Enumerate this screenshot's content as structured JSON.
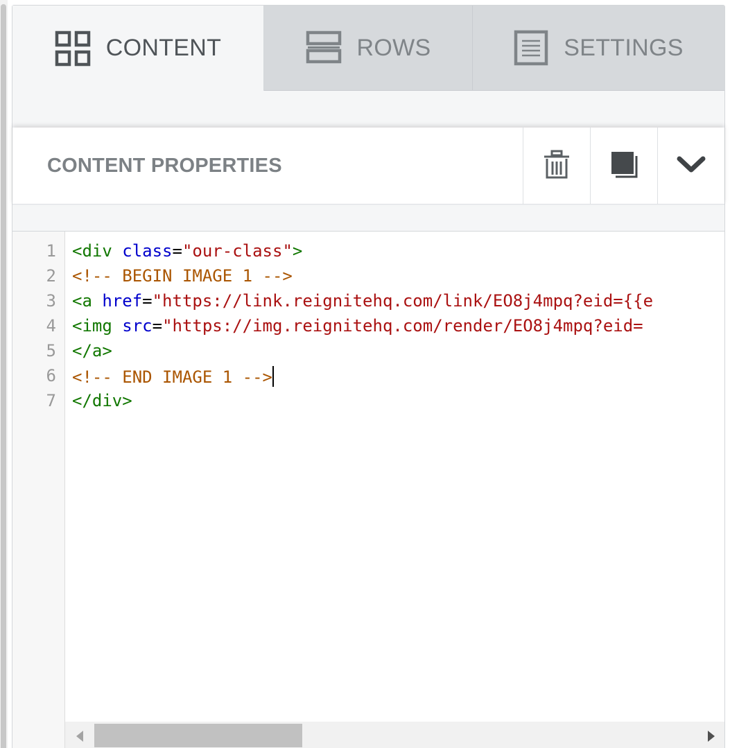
{
  "tabs": {
    "content": {
      "label": "CONTENT",
      "icon": "grid-icon"
    },
    "rows": {
      "label": "ROWS",
      "icon": "rows-icon"
    },
    "settings": {
      "label": "SETTINGS",
      "icon": "settings-doc-icon"
    }
  },
  "properties": {
    "title": "CONTENT PROPERTIES",
    "actions": [
      "trash-icon",
      "duplicate-icon",
      "chevron-down-icon"
    ]
  },
  "editor": {
    "line_numbers": [
      "1",
      "2",
      "3",
      "4",
      "5",
      "6",
      "7"
    ],
    "lines": [
      {
        "parts": [
          {
            "t": "<div",
            "c": "tag"
          },
          {
            "t": " ",
            "c": ""
          },
          {
            "t": "class",
            "c": "attr"
          },
          {
            "t": "=",
            "c": ""
          },
          {
            "t": "\"our-class\"",
            "c": "str"
          },
          {
            "t": ">",
            "c": "tag"
          }
        ]
      },
      {
        "parts": [
          {
            "t": "<!-- BEGIN IMAGE 1 -->",
            "c": "cmt"
          }
        ]
      },
      {
        "parts": [
          {
            "t": "<a",
            "c": "tag"
          },
          {
            "t": " ",
            "c": ""
          },
          {
            "t": "href",
            "c": "attr"
          },
          {
            "t": "=",
            "c": ""
          },
          {
            "t": "\"https://link.reignitehq.com/link/EO8j4mpq?eid={{e",
            "c": "str"
          }
        ]
      },
      {
        "parts": [
          {
            "t": "<img",
            "c": "tag"
          },
          {
            "t": " ",
            "c": ""
          },
          {
            "t": "src",
            "c": "attr"
          },
          {
            "t": "=",
            "c": ""
          },
          {
            "t": "\"https://img.reignitehq.com/render/EO8j4mpq?eid=",
            "c": "str"
          }
        ]
      },
      {
        "parts": [
          {
            "t": "</a>",
            "c": "tag"
          }
        ]
      },
      {
        "parts": [
          {
            "t": "<!-- END IMAGE 1 -->",
            "c": "cmt"
          }
        ],
        "cursor": true
      },
      {
        "parts": [
          {
            "t": "</div>",
            "c": "tag"
          }
        ]
      }
    ]
  },
  "colors": {
    "tag": "#117700",
    "attr": "#0000cc",
    "string": "#aa1111",
    "comment": "#aa5500"
  }
}
